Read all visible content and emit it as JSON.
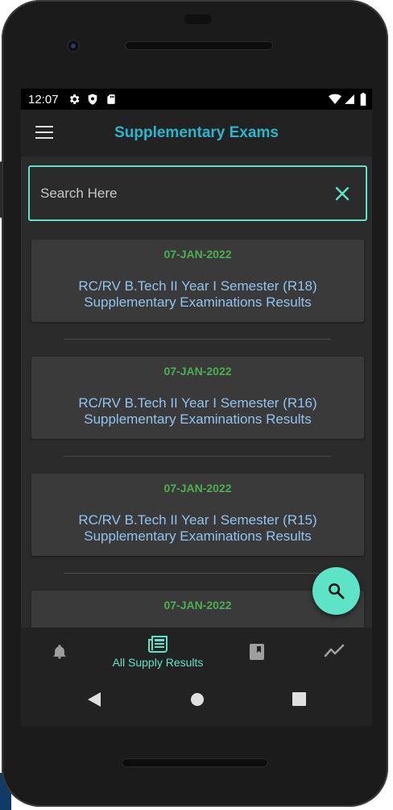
{
  "status_bar": {
    "time": "12:07"
  },
  "app_bar": {
    "title": "Supplementary Exams"
  },
  "search": {
    "placeholder": "Search Here",
    "value": ""
  },
  "results": [
    {
      "date": "07-JAN-2022",
      "line1": "RC/RV B.Tech II Year I Semester (R18)",
      "line2": "Supplementary Examinations Results"
    },
    {
      "date": "07-JAN-2022",
      "line1": "RC/RV B.Tech II Year I Semester (R16)",
      "line2": "Supplementary Examinations Results"
    },
    {
      "date": "07-JAN-2022",
      "line1": "RC/RV B.Tech II Year I Semester (R15)",
      "line2": "Supplementary Examinations Results"
    },
    {
      "date": "07-JAN-2022"
    }
  ],
  "bottom_nav": {
    "items": [
      {
        "icon": "bell-icon",
        "label": ""
      },
      {
        "icon": "newspaper-icon",
        "label": "All Supply Results",
        "active": true
      },
      {
        "icon": "bookmark-book-icon",
        "label": ""
      },
      {
        "icon": "trending-icon",
        "label": ""
      }
    ]
  },
  "colors": {
    "accent": "#5de4c7",
    "title": "#29b6cf",
    "date": "#4caf50",
    "link": "#90c4f0",
    "background": "#2b2b2b",
    "card": "#3a3a3a"
  }
}
